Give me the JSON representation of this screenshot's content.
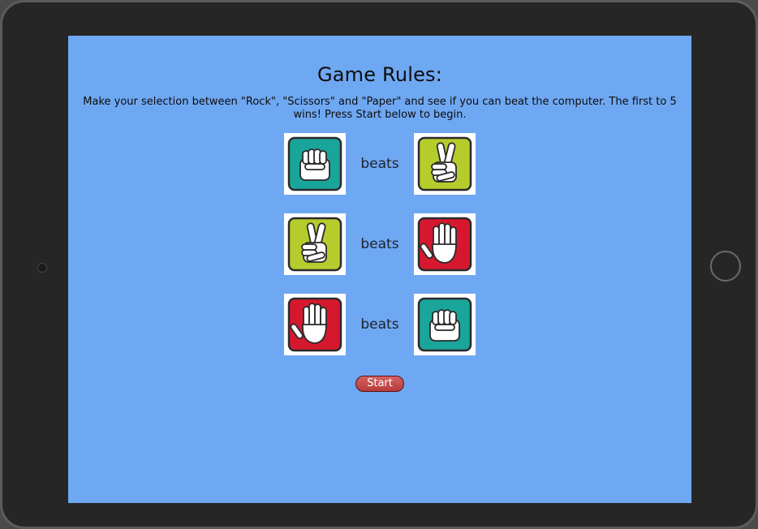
{
  "screen": {
    "title": "Game Rules:",
    "description": "Make your selection between \"Rock\", \"Scissors\" and \"Paper\" and see if you can beat the computer. The first to 5 wins! Press Start below to begin."
  },
  "rules": [
    {
      "winner": "rock-icon",
      "label": "beats",
      "loser": "scissors-icon"
    },
    {
      "winner": "scissors-icon",
      "label": "beats",
      "loser": "paper-icon"
    },
    {
      "winner": "paper-icon",
      "label": "beats",
      "loser": "rock-icon"
    }
  ],
  "start_button": {
    "label": "Start"
  },
  "colors": {
    "background": "#6fa8f2",
    "rock": "#1aa59b",
    "scissors": "#b5cc2c",
    "paper": "#d6182e",
    "start_button": "#c94b4b"
  }
}
